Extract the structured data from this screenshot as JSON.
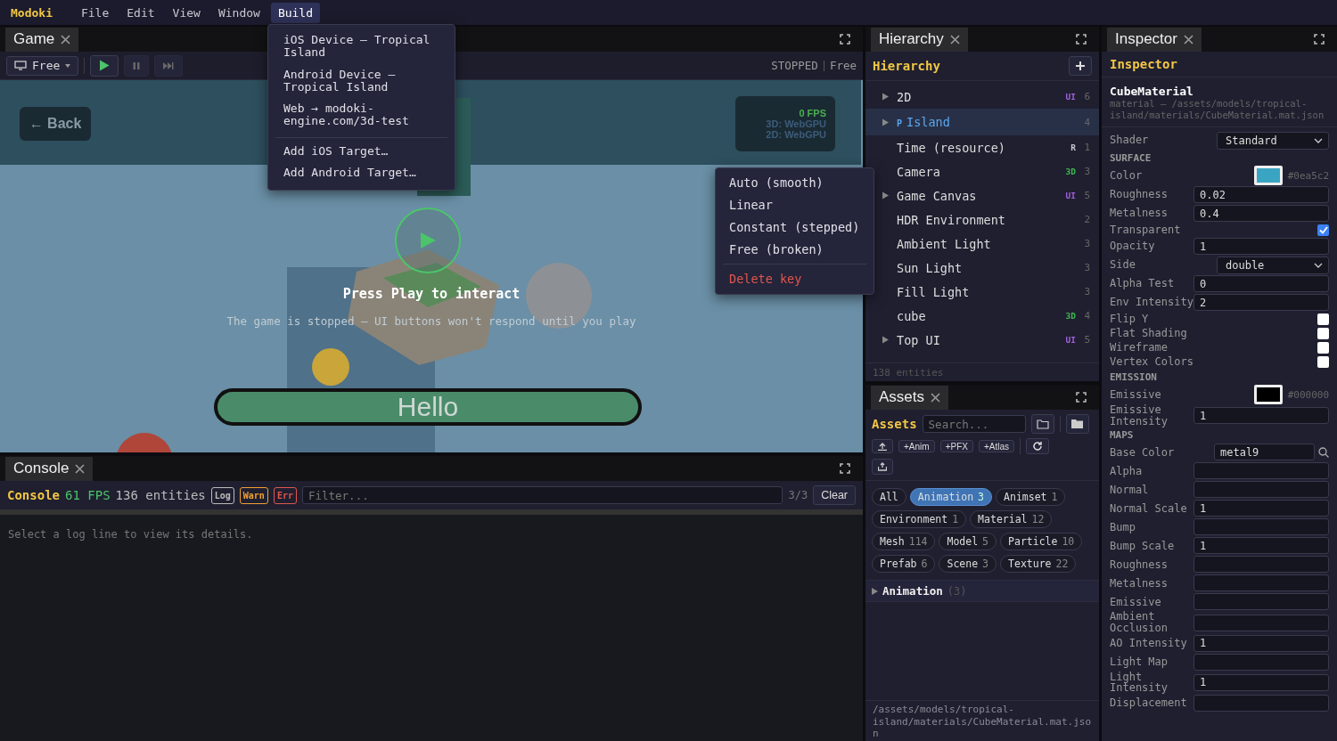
{
  "menubar": {
    "logo": "Modoki",
    "items": [
      {
        "label": "File",
        "selected": false
      },
      {
        "label": "Edit",
        "selected": false
      },
      {
        "label": "View",
        "selected": false
      },
      {
        "label": "Window",
        "selected": false
      },
      {
        "label": "Build",
        "selected": true
      }
    ]
  },
  "build_menu": {
    "groups": [
      [
        "iOS Device — Tropical Island",
        "Android Device — Tropical Island",
        "Web → modoki-engine.com/3d-test"
      ],
      [
        "Add iOS Target…",
        "Add Android Target…"
      ]
    ]
  },
  "game": {
    "tab": "Game",
    "display_select": "Free",
    "status": "STOPPED",
    "mode": "Free",
    "back_button": "← Back",
    "fps": "0 FPS",
    "renderers": [
      "3D: WebGPU",
      "2D: WebGPU"
    ],
    "overlay_title": "Press Play to interact",
    "overlay_subtitle": "The game is stopped — UI buttons won't respond until you play",
    "hello_button": "Hello"
  },
  "curve_menu": {
    "items": [
      {
        "label": "Auto (smooth)",
        "kind": "option"
      },
      {
        "label": "Linear",
        "kind": "option"
      },
      {
        "label": "Constant (stepped)",
        "kind": "option"
      },
      {
        "label": "Free (broken)",
        "kind": "option"
      },
      {
        "label": "Delete key",
        "kind": "danger"
      }
    ]
  },
  "console": {
    "tab": "Console",
    "title": "Console",
    "fps": "61 FPS",
    "entities": "136 entities",
    "level_buttons": [
      {
        "label": "Log",
        "kind": "log"
      },
      {
        "label": "Warn",
        "kind": "warn"
      },
      {
        "label": "Err",
        "kind": "error"
      }
    ],
    "filter_placeholder": "Filter...",
    "count": "3/3",
    "clear_button": "Clear",
    "empty_message": "Select a log line to view its details."
  },
  "hierarchy": {
    "tab": "Hierarchy",
    "title": "Hierarchy",
    "items": [
      {
        "label": "2D",
        "expandable": true,
        "selected": false,
        "tag": "UI",
        "color": "#a060d8",
        "count": "6"
      },
      {
        "label": "Island",
        "prefix": "P",
        "expandable": true,
        "selected": true,
        "count": "4"
      },
      {
        "label": "Time (resource)",
        "expandable": false,
        "selected": false,
        "tag": "R",
        "color": "#c8c8d0",
        "count": "1"
      },
      {
        "label": "Camera",
        "expandable": false,
        "selected": false,
        "tag": "3D",
        "color": "#3fb950",
        "count": "3"
      },
      {
        "label": "Game Canvas",
        "expandable": true,
        "selected": false,
        "tag": "UI",
        "color": "#a060d8",
        "count": "5"
      },
      {
        "label": "HDR Environment",
        "expandable": false,
        "selected": false,
        "count": "2"
      },
      {
        "label": "Ambient Light",
        "expandable": false,
        "selected": false,
        "count": "3"
      },
      {
        "label": "Sun Light",
        "expandable": false,
        "selected": false,
        "count": "3"
      },
      {
        "label": "Fill Light",
        "expandable": false,
        "selected": false,
        "count": "3"
      },
      {
        "label": "cube",
        "expandable": false,
        "selected": false,
        "tag": "3D",
        "color": "#3fb950",
        "count": "4"
      },
      {
        "label": "Top UI",
        "expandable": true,
        "selected": false,
        "tag": "UI",
        "color": "#a060d8",
        "count": "5"
      }
    ],
    "footer": "138 entities"
  },
  "assets": {
    "tab": "Assets",
    "title": "Assets",
    "search_placeholder": "Search...",
    "create_buttons": [
      "+Anim",
      "+PFX",
      "+Atlas"
    ],
    "filters": [
      {
        "label": "All",
        "selected": false
      },
      {
        "label": "Animation",
        "count": "3",
        "selected": true
      },
      {
        "label": "Animset",
        "count": "1",
        "selected": false
      },
      {
        "label": "Environment",
        "count": "1",
        "selected": false
      },
      {
        "label": "Material",
        "count": "12",
        "selected": false
      },
      {
        "label": "Mesh",
        "count": "114",
        "selected": false
      },
      {
        "label": "Model",
        "count": "5",
        "selected": false
      },
      {
        "label": "Particle",
        "count": "10",
        "selected": false
      },
      {
        "label": "Prefab",
        "count": "6",
        "selected": false
      },
      {
        "label": "Scene",
        "count": "3",
        "selected": false
      },
      {
        "label": "Texture",
        "count": "22",
        "selected": false
      }
    ],
    "group": {
      "label": "Animation",
      "count": "(3)",
      "expanded": false
    },
    "footer_path": "/assets/models/tropical-island/materials/CubeMaterial.mat.json"
  },
  "inspector": {
    "tab": "Inspector",
    "title": "Inspector",
    "asset_name": "CubeMaterial",
    "asset_path": "material — /assets/models/tropical-island/materials/CubeMaterial.mat.json",
    "rows": [
      {
        "kind": "select",
        "label": "Shader",
        "value": "Standard"
      },
      {
        "kind": "section",
        "label": "SURFACE"
      },
      {
        "kind": "color",
        "label": "Color",
        "value": "#0ea5c2",
        "color": "#3aa5c2"
      },
      {
        "kind": "input",
        "label": "Roughness",
        "value": "0.02"
      },
      {
        "kind": "input",
        "label": "Metalness",
        "value": "0.4"
      },
      {
        "kind": "checkbox",
        "label": "Transparent",
        "checked": true
      },
      {
        "kind": "input",
        "label": "Opacity",
        "value": "1"
      },
      {
        "kind": "select",
        "label": "Side",
        "value": "double"
      },
      {
        "kind": "input",
        "label": "Alpha Test",
        "value": "0"
      },
      {
        "kind": "input",
        "label": "Env Intensity",
        "value": "2"
      },
      {
        "kind": "checkbox",
        "label": "Flip Y",
        "checked": false
      },
      {
        "kind": "checkbox",
        "label": "Flat Shading",
        "checked": false
      },
      {
        "kind": "checkbox",
        "label": "Wireframe",
        "checked": false
      },
      {
        "kind": "checkbox",
        "label": "Vertex Colors",
        "checked": false
      },
      {
        "kind": "section",
        "label": "EMISSION"
      },
      {
        "kind": "color",
        "label": "Emissive",
        "value": "#000000",
        "color": "#000000"
      },
      {
        "kind": "input",
        "label": "Emissive Intensity",
        "value": "1"
      },
      {
        "kind": "section",
        "label": "MAPS"
      },
      {
        "kind": "texture",
        "label": "Base Color",
        "value": "metal9"
      },
      {
        "kind": "input",
        "label": "Alpha"
      },
      {
        "kind": "input",
        "label": "Normal"
      },
      {
        "kind": "input",
        "label": "Normal Scale",
        "value": "1"
      },
      {
        "kind": "input",
        "label": "Bump"
      },
      {
        "kind": "input",
        "label": "Bump Scale",
        "value": "1"
      },
      {
        "kind": "input",
        "label": "Roughness"
      },
      {
        "kind": "input",
        "label": "Metalness"
      },
      {
        "kind": "input",
        "label": "Emissive"
      },
      {
        "kind": "input",
        "label": "Ambient Occlusion"
      },
      {
        "kind": "input",
        "label": "AO Intensity",
        "value": "1"
      },
      {
        "kind": "input",
        "label": "Light Map"
      },
      {
        "kind": "input",
        "label": "Light Intensity",
        "value": "1"
      },
      {
        "kind": "input",
        "label": "Displacement"
      }
    ]
  }
}
